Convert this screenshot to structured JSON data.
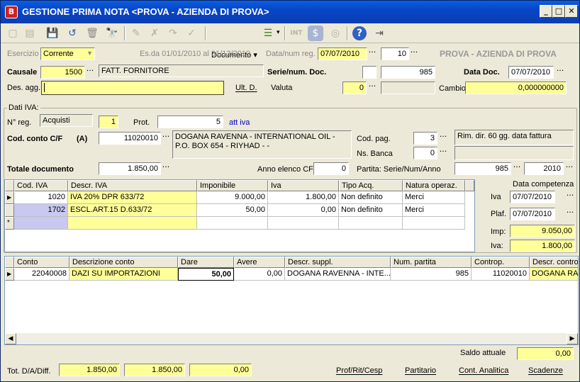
{
  "window": {
    "title": "GESTIONE PRIMA NOTA <PROVA - AZIENDA DI PROVA>",
    "app_icon": "B"
  },
  "toolbar": {
    "documento_label": "Documento",
    "int_label": "INT"
  },
  "header": {
    "esercizio_label": "Esercizio",
    "esercizio_value": "Corrente",
    "period": "Es.da 01/01/2010 al 31/12/2010",
    "data_num_reg_label": "Data/num reg.",
    "data_reg": "07/07/2010",
    "num_reg": "10",
    "company": "PROVA - AZIENDA DI PROVA",
    "causale_label": "Causale",
    "causale_code": "1500",
    "causale_desc": "FATT. FORNITORE",
    "serie_num_doc_label": "Serie/num. Doc.",
    "serie_doc": "",
    "num_doc": "985",
    "data_doc_label": "Data Doc.",
    "data_doc": "07/07/2010",
    "des_agg_label": "Des. agg.",
    "des_agg": "",
    "ult_d_label": "Ult. D.",
    "valuta_label": "Valuta",
    "valuta": "0",
    "cambio_label": "Cambio",
    "cambio": "0,000000000"
  },
  "iva": {
    "group_label": "Dati IVA:",
    "nreg_label": "N° reg.",
    "nreg_type": "Acquisti",
    "nreg_num": "1",
    "prot_label": "Prot.",
    "prot_num": "5",
    "att_iva": "att iva",
    "cod_conto_label": "Cod. conto C/F",
    "cod_conto_type": "(A)",
    "cod_conto": "11020010",
    "cod_conto_desc": "DOGANA RAVENNA - INTERNATIONAL OIL  - P.O. BOX 654 - RIYHAD  -  -",
    "cod_pag_label": "Cod. pag.",
    "cod_pag": "3",
    "cod_pag_desc": "Rim. dir. 60 gg. data fattura",
    "ns_banca_label": "Ns. Banca",
    "ns_banca": "0",
    "totale_doc_label": "Totale documento",
    "totale_doc": "1.850,00",
    "anno_elenco_label": "Anno elenco CF",
    "anno_elenco": "0",
    "partita_label": "Partita: Serie/Num/Anno",
    "partita_num": "985",
    "partita_anno": "2010",
    "columns": [
      "Cod. IVA",
      "Descr. IVA",
      "Imponibile",
      "Iva",
      "Tipo Acq.",
      "Natura operaz."
    ],
    "rows": [
      {
        "cod": "1020",
        "descr": "IVA 20% DPR 633/72",
        "imponibile": "9.000,00",
        "iva": "1.800,00",
        "tipo": "Non definito",
        "natura": "Merci"
      },
      {
        "cod": "1702",
        "descr": "ESCL.ART.15 D.633/72",
        "imponibile": "50,00",
        "iva": "0,00",
        "tipo": "Non definito",
        "natura": "Merci"
      }
    ],
    "new_row_marker": "*",
    "competenza_label": "Data competenza",
    "comp_iva_label": "Iva",
    "comp_iva": "07/07/2010",
    "plaf_label": "Plaf.",
    "plaf": "07/07/2010",
    "imp_label": "Imp:",
    "imp": "9.050,00",
    "iva_tot_label": "Iva:",
    "iva_tot": "1.800,00"
  },
  "movimenti": {
    "columns": [
      "Conto",
      "Descrizione conto",
      "Dare",
      "Avere",
      "Descr. suppl.",
      "Num. partita",
      "Controp.",
      "Descr. contro"
    ],
    "rows": [
      {
        "conto": "22040008",
        "descr": "DAZI SU IMPORTAZIONI",
        "dare": "50,00",
        "avere": "0,00",
        "suppl": "DOGANA RAVENNA - INTE...",
        "partita": "985",
        "controp": "11020010",
        "descr_contro": "DOGANA RAVE"
      }
    ]
  },
  "footer": {
    "saldo_label": "Saldo attuale",
    "saldo": "0,00",
    "tot_label": "Tot. D/A/Diff.",
    "tot_dare": "1.850,00",
    "tot_avere": "1.850,00",
    "tot_diff": "0,00",
    "links": [
      "Prof/Rit/Cesp",
      "Partitario",
      "Cont. Analitica",
      "Scadenze"
    ]
  },
  "colors": {
    "title_bar": "#0845C8",
    "field_yellow": "#FFFF99",
    "selection": "#C8C8F0",
    "link_blue": "#0000C0"
  }
}
